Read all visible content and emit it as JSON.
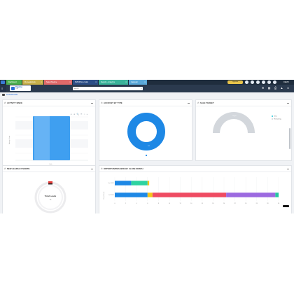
{
  "tabs": [
    {
      "label": "Dashboard",
      "color": "#4caf50"
    },
    {
      "label": "My Leads/Acts",
      "color": "#c8b04a"
    },
    {
      "label": "Sales Pipeline",
      "color": "#e06a6a"
    },
    {
      "label": "SMS/Phone Calls",
      "color": "#2c4e86"
    },
    {
      "label": "Reports - Analytics",
      "color": "#3bb39a"
    },
    {
      "label": "Calendar",
      "color": "#5aa8d8"
    }
  ],
  "header": {
    "badge": "Upgrade",
    "user": "DEMO",
    "search_placeholder": "Search",
    "logo_name": "Pipeline",
    "logo_sub": "CRM"
  },
  "breadcrumb": "DASHBOARD",
  "cards": {
    "activity": {
      "title": "ACTIVITY SINCE"
    },
    "account": {
      "title": "ACCOUNT BY TYPE"
    },
    "sale": {
      "title": "SALE TARGET"
    },
    "newleads": {
      "title": "NEW LEADS BY MONTH"
    },
    "opps": {
      "title": "OPPORTUNITIES WON BY CLOSE MONTH"
    }
  },
  "activity_chart": {
    "ylabel": "Activity Count",
    "category": "Calls",
    "toolbar": "⊖ ⊕ 🔍 ☰ ⌂ ≡"
  },
  "account_chart": {
    "center_label": "1.0",
    "accent": "#1e88e5"
  },
  "sale_chart": {
    "top_label": "Target",
    "legend": [
      {
        "label": "Won",
        "color": "#1ec3d6"
      },
      {
        "label": "Remaining",
        "color": "#cfd4d9"
      }
    ]
  },
  "leads_chart": {
    "label": "Total Leads",
    "value": "10"
  },
  "chart_data": [
    {
      "type": "bar",
      "title": "OPPORTUNITIES WON BY CLOSE MONTH",
      "orientation": "horizontal",
      "categories": [
        "Jun 2024",
        "Jul 2024"
      ],
      "xlim": [
        0,
        30
      ],
      "x_ticks": [
        "0",
        "2",
        "4",
        "6",
        "8",
        "10",
        "12",
        "14",
        "16",
        "18",
        "20",
        "22",
        "24",
        "26",
        "28",
        "30"
      ],
      "ylabel": "Close Month",
      "series": [
        {
          "color": "#1e88e5",
          "values": [
            3,
            6
          ]
        },
        {
          "color": "#2ed3a0",
          "values": [
            3,
            0
          ]
        },
        {
          "color": "#f5c518",
          "values": [
            0.3,
            0.9
          ]
        },
        {
          "color": "#ef4b62",
          "values": [
            0,
            13.5
          ]
        },
        {
          "color": "#9c6ae0",
          "values": [
            0,
            9
          ]
        },
        {
          "color": "#26c6a0",
          "values": [
            0,
            0.6
          ]
        }
      ]
    }
  ]
}
